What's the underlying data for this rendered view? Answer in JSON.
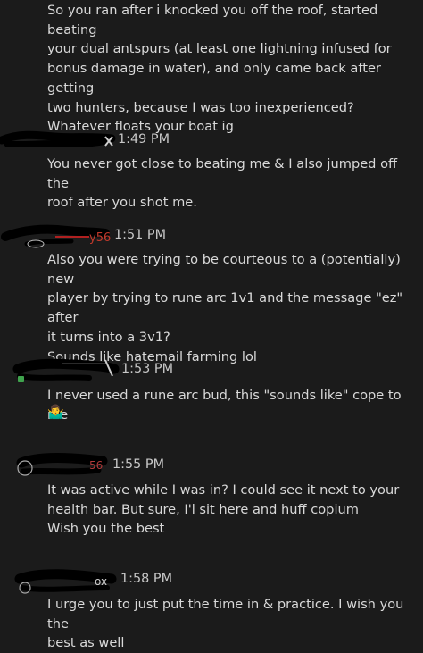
{
  "messages": [
    {
      "sender": "",
      "time": "",
      "text": "So you ran after i knocked you off the roof, started beating\nyour dual antspurs (at least one lightning infused for\nbonus damage in water), and only came back after getting\ntwo hunters,  because I was too inexperienced?\nWhatever floats your boat ig"
    },
    {
      "sender": "x",
      "time": "1:49 PM",
      "text": "You never got close to beating me & I also jumped off the\nroof after you shot me."
    },
    {
      "sender": "y56",
      "time": "1:51 PM",
      "text": "Also you were trying to be courteous to a (potentially) new\nplayer by trying to rune arc 1v1 and the message \"ez\" after\nit turns into a 3v1?\nSounds like hatemail farming lol"
    },
    {
      "sender": "",
      "time": "1:53 PM",
      "text": "I never used a rune arc bud, this \"sounds like\" cope to me",
      "emoji": "🤷‍♂️"
    },
    {
      "sender": "56",
      "time": "1:55 PM",
      "text": "It was active while I was in? I could see it next to your\nhealth bar. But sure, I'l sit here and huff copium\nWish you the best"
    },
    {
      "sender": "ox",
      "time": "1:58 PM",
      "text": "I urge you to just put the time in & practice. I wish you the\nbest as well"
    }
  ]
}
